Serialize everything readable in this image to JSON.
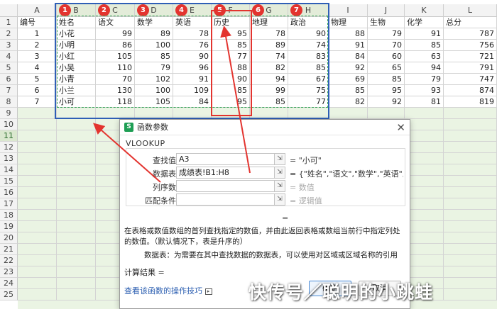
{
  "sheet": {
    "columns": [
      "A",
      "B",
      "C",
      "D",
      "E",
      "F",
      "G",
      "H",
      "I",
      "J",
      "K",
      "L"
    ],
    "rows": [
      "1",
      "2",
      "3",
      "4",
      "5",
      "6",
      "7",
      "8",
      "9",
      "10",
      "11",
      "12",
      "13",
      "14",
      "15",
      "16",
      "17",
      "18",
      "19",
      "20",
      "21",
      "22",
      "23",
      "24",
      "25"
    ],
    "selected_row": "11",
    "header": [
      "编号",
      "姓名",
      "语文",
      "数学",
      "英语",
      "历史",
      "地理",
      "政治",
      "物理",
      "生物",
      "化学",
      "总分"
    ],
    "data": [
      [
        "1",
        "小花",
        "99",
        "89",
        "78",
        "95",
        "78",
        "90",
        "88",
        "79",
        "91",
        "787"
      ],
      [
        "2",
        "小明",
        "86",
        "100",
        "76",
        "85",
        "89",
        "74",
        "91",
        "70",
        "85",
        "756"
      ],
      [
        "3",
        "小红",
        "105",
        "85",
        "90",
        "77",
        "74",
        "83",
        "84",
        "60",
        "63",
        "721"
      ],
      [
        "4",
        "小吴",
        "110",
        "79",
        "96",
        "88",
        "82",
        "85",
        "92",
        "65",
        "94",
        "791"
      ],
      [
        "5",
        "小青",
        "70",
        "102",
        "91",
        "90",
        "94",
        "67",
        "69",
        "85",
        "79",
        "747"
      ],
      [
        "6",
        "小兰",
        "130",
        "100",
        "109",
        "85",
        "99",
        "75",
        "85",
        "95",
        "93",
        "874"
      ],
      [
        "7",
        "小可",
        "118",
        "105",
        "84",
        "95",
        "85",
        "77",
        "82",
        "92",
        "81",
        "819"
      ]
    ],
    "badges": [
      "1",
      "2",
      "3",
      "4",
      "5",
      "6",
      "7"
    ],
    "colors": {
      "accent_red": "#e3342f",
      "accent_blue": "#2f5fb6",
      "grid_green": "#eaf4e3"
    }
  },
  "dialog": {
    "title": "函数参数",
    "function_name": "VLOOKUP",
    "args": [
      {
        "label": "查找值",
        "value": "A3",
        "result": "= \"小可\"",
        "result_muted": false
      },
      {
        "label": "数据表",
        "value": "成绩表!B1:H8",
        "result": "= {\"姓名\",\"语文\",\"数学\",\"英语\",\"...",
        "result_muted": false
      },
      {
        "label": "列序数",
        "value": "",
        "result": "= 数值",
        "result_muted": true
      },
      {
        "label": "匹配条件",
        "value": "",
        "result": "= 逻辑值",
        "result_muted": true
      }
    ],
    "equals": "=",
    "description": "在表格或数值数组的首列查找指定的数值，并由此返回表格或数组当前行中指定列处的数值。（默认情况下，表是升序的）",
    "arg_help": "数据表：为需要在其中查找数据的数据表，可以使用对区域或区域名称的引用",
    "calc_result": "计算结果 =",
    "help_link": "查看该函数的操作技巧",
    "ok_label": "确定",
    "cancel_label": "取消",
    "close_icon": "close-icon",
    "ref_icon": "range-select-icon"
  },
  "watermark": "快传号／聪明的小跳蛙"
}
